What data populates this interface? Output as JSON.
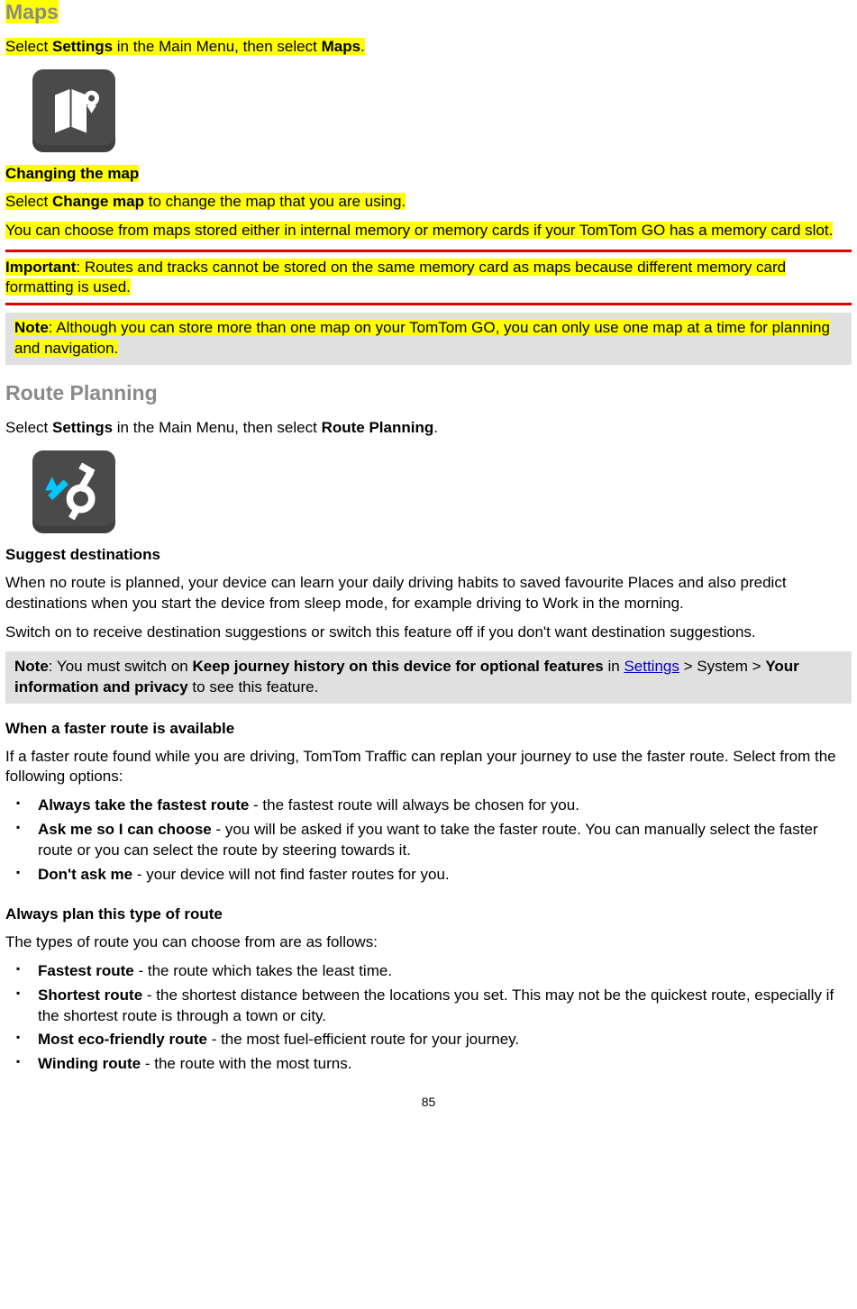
{
  "sections": {
    "maps": {
      "title": "Maps",
      "intro": {
        "pre": "Select ",
        "settings": "Settings",
        "mid": " in the Main Menu, then select ",
        "target": "Maps",
        "post": ". "
      },
      "changing_map_head": "Changing the map",
      "change_map_pre": "Select ",
      "change_map_bold": "Change map",
      "change_map_post": " to change the map that you are using.",
      "memory_line": "You can choose from maps stored either in internal memory or memory cards if your TomTom GO has a memory card slot.",
      "important": {
        "label": "Important",
        "text": ": Routes and tracks cannot be stored on the same memory card as maps because different memory card formatting is used."
      },
      "note": {
        "label": "Note",
        "text": ": Although you can store more than one map on your TomTom GO, you can only use one map at a time for planning and navigation. "
      }
    },
    "route": {
      "title": "Route Planning",
      "intro": {
        "pre": "Select ",
        "settings": "Settings",
        "mid": " in the Main Menu, then select ",
        "target": "Route Planning",
        "post": "."
      },
      "suggest_head": "Suggest destinations",
      "suggest_p1": "When no route is planned, your device can learn your daily driving habits to saved favourite Places and also predict destinations when you start the device from sleep mode, for example driving to Work in the morning.",
      "suggest_p2": "Switch on to receive destination suggestions or switch this feature off if you don't want destination suggestions.",
      "note": {
        "label": "Note",
        "pre": ": You must switch on ",
        "bold1": "Keep journey history on this device for optional features",
        "mid1": " in ",
        "link": "Settings",
        "mid2": " > System > ",
        "bold2": "Your information and privacy",
        "post": " to see this feature."
      },
      "faster_head": "When a faster route is available",
      "faster_intro": "If a faster route found while you are driving, TomTom Traffic can replan your journey to use the faster route. Select from the following options:",
      "faster_options": [
        {
          "bold": "Always take the fastest route",
          "rest": " - the fastest route will always be chosen for you."
        },
        {
          "bold": "Ask me so I can choose",
          "rest": " - you will be asked if you want to take the faster route. You can manually select the faster route or you can select the route by steering towards it."
        },
        {
          "bold": "Don't ask me",
          "rest": " - your device will not find faster routes for you."
        }
      ],
      "plan_head": "Always plan this type of route",
      "plan_intro": "The types of route you can choose from are as follows:",
      "plan_options": [
        {
          "bold": "Fastest route",
          "rest": " - the route which takes the least time."
        },
        {
          "bold": "Shortest route",
          "rest": " - the shortest distance between the locations you set. This may not be the quickest route, especially if the shortest route is through a town or city."
        },
        {
          "bold": "Most eco-friendly route",
          "rest": " - the most fuel-efficient route for your journey."
        },
        {
          "bold": "Winding route",
          "rest": " - the route with the most turns."
        }
      ]
    }
  },
  "page_num": "85"
}
